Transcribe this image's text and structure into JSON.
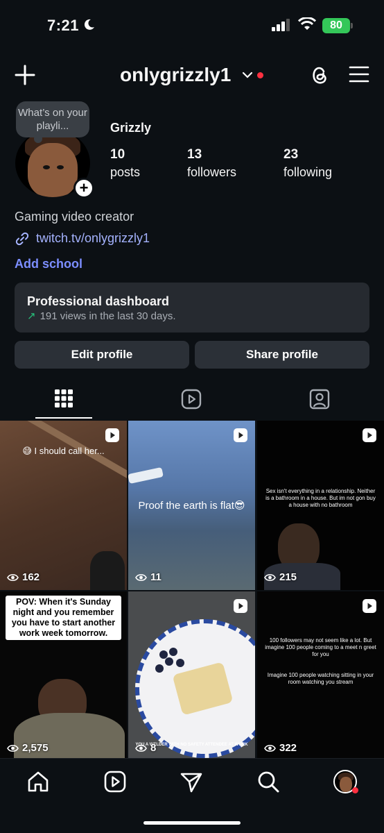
{
  "status_bar": {
    "time": "7:21",
    "battery": "80"
  },
  "header": {
    "username": "onlygrizzly1"
  },
  "profile": {
    "note": "What’s on your playli...",
    "display_name": "Grizzly",
    "stats": [
      {
        "value": "10",
        "label": "posts"
      },
      {
        "value": "13",
        "label": "followers"
      },
      {
        "value": "23",
        "label": "following"
      }
    ],
    "bio": "Gaming video creator",
    "link": "twitch.tv/onlygrizzly1",
    "add_school": "Add school"
  },
  "dashboard": {
    "title": "Professional dashboard",
    "subtitle": "191 views in the last 30 days."
  },
  "buttons": {
    "edit": "Edit profile",
    "share": "Share profile"
  },
  "posts": [
    {
      "caption": "😅 I should call her...",
      "views": "162"
    },
    {
      "caption": "Proof the earth is flat😎",
      "views": "11"
    },
    {
      "caption": "Sex isn't everything in a relationship. Neither is a bathroom in a house. But im not gon buy a house with no bathroom",
      "views": "215"
    },
    {
      "caption": "POV: When it's Sunday night and you remember you have to start another work week tomorrow.",
      "views": "2,575"
    },
    {
      "caption": "YOU A WELDER WITH NO SAFETY ATTENDEE AT WORK",
      "views": "8"
    },
    {
      "caption": "100 followers may not seem like a lot. But imagine 100 people coming to a meet n greet for you",
      "caption2": "Imagine 100 people watching sitting in your room watching you stream",
      "views": "322"
    }
  ],
  "colors": {
    "background": "#0c1014",
    "accent_link": "#a5b3ff",
    "school": "#7c8eff",
    "trend_up": "#27c07a",
    "notification": "#ff3040",
    "battery": "#34c759"
  },
  "icons": [
    "moon-icon",
    "signal-icon",
    "wifi-icon",
    "plus-icon",
    "chevron-down-icon",
    "threads-icon",
    "menu-icon",
    "link-icon",
    "grid-icon",
    "reels-icon",
    "tagged-icon",
    "eye-icon",
    "home-icon",
    "send-icon",
    "search-icon"
  ]
}
